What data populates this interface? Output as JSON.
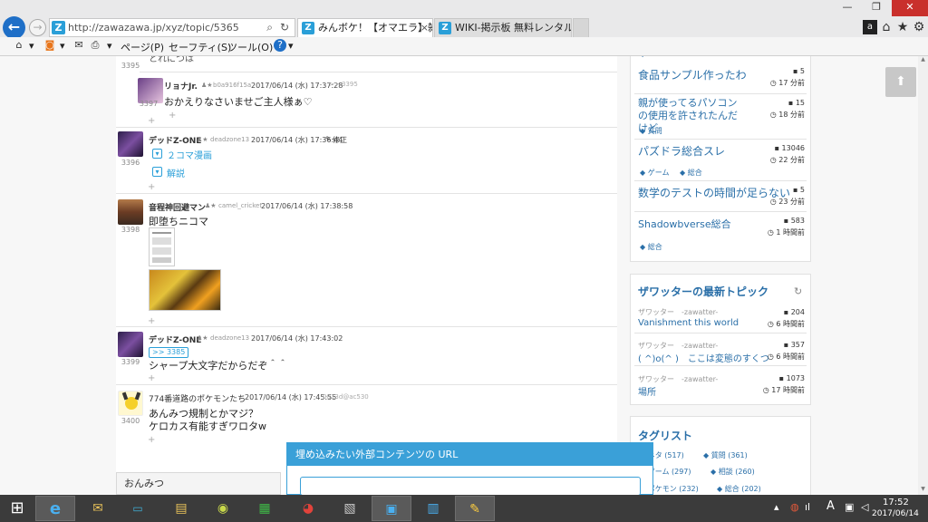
{
  "browser": {
    "url": "http://zawazawa.jp/xyz/topic/5365",
    "tabs": [
      {
        "label": "みんボケ！【オマエラ】雑談総...",
        "close": "×"
      },
      {
        "label": "WIKI-掲示板 無料レンタル za..."
      }
    ],
    "command_bar": {
      "page": "ページ(P)",
      "safety": "セーフティ(S)",
      "tools": "ツール(O)"
    }
  },
  "posts": [
    {
      "num": "3395",
      "body": "とれにつは"
    },
    {
      "num": "3397",
      "name": "リョナJr.",
      "id": "b0a916f15a",
      "date": "2017/06/14 (水) 17:37:28",
      "anchor": ">> 3395",
      "body": "おかえりなさいませご主人様ぁ♡"
    },
    {
      "num": "3396",
      "name": "デッドZ-ONE",
      "id": "deadzone13",
      "date": "2017/06/14 (水) 17:36:44",
      "edited": "修正",
      "links": [
        "２コマ漫画",
        "解説"
      ]
    },
    {
      "num": "3398",
      "name": "音程神回避マン",
      "id": "camel_cricket",
      "date": "2017/06/14 (水) 17:38:58",
      "body": "即堕ちニコマ"
    },
    {
      "num": "3399",
      "name": "デッドZ-ONE",
      "id": "deadzone13",
      "date": "2017/06/14 (水) 17:43:02",
      "anchor": ">> 3385",
      "body": "シャープ大文字だからだぞ＾＾"
    },
    {
      "num": "3400",
      "name": "774番道路のポケモンたち",
      "id": "0813d@ac530",
      "date": "2017/06/14 (水) 17:45:55",
      "body_lines": [
        "あんみつ規制とかマジ？",
        "ケロカス有能すぎワロタw"
      ]
    }
  ],
  "sidebar": {
    "top_list": [
      {
        "title": "食品サンプル作ったわ",
        "count": "5",
        "time": "17 分前"
      },
      {
        "title": "親が使ってるパソコンの使用を許されたんだけど",
        "count": "15",
        "time": "18 分前",
        "tags": [
          "質問"
        ]
      },
      {
        "title": "パズドラ総合スレ",
        "count": "13046",
        "time": "22 分前",
        "tags": [
          "ゲーム",
          "総合"
        ]
      },
      {
        "title": "数学のテストの時間が足らない",
        "count": "5",
        "time": "23 分前"
      },
      {
        "title": "Shadowbverse総合",
        "count": "583",
        "time": "1 時間前",
        "tags": [
          "総合"
        ]
      }
    ],
    "zawatter": {
      "heading": "ザワッターの最新トピック",
      "items": [
        {
          "src": "ザワッター",
          "user": "-zawatter-",
          "title": "Vanishment this world",
          "count": "204",
          "time": "6 時間前"
        },
        {
          "src": "ザワッター",
          "user": "-zawatter-",
          "title": "( ^)o(^ )　ここは変態のすくつ",
          "count": "357",
          "time": "6 時間前"
        },
        {
          "src": "ザワッター",
          "user": "-zawatter-",
          "title": "場所",
          "count": "1073",
          "time": "17 時間前"
        }
      ]
    },
    "taglist": {
      "heading": "タグリスト",
      "tags": [
        "ネタ (517)",
        "質問 (361)",
        "ゲーム (297)",
        "相談 (260)",
        "ポケモン (232)",
        "総合 (202)"
      ]
    }
  },
  "bottom_tab": "おんみつ",
  "embed": {
    "heading": "埋め込みたい外部コンテンツの URL"
  },
  "clock": {
    "time": "17:52",
    "date": "2017/06/14"
  },
  "ime": "A",
  "colors": {
    "accent": "#2a9fd8",
    "taskbar": "#3b3b3b",
    "close": "#c9302c"
  }
}
